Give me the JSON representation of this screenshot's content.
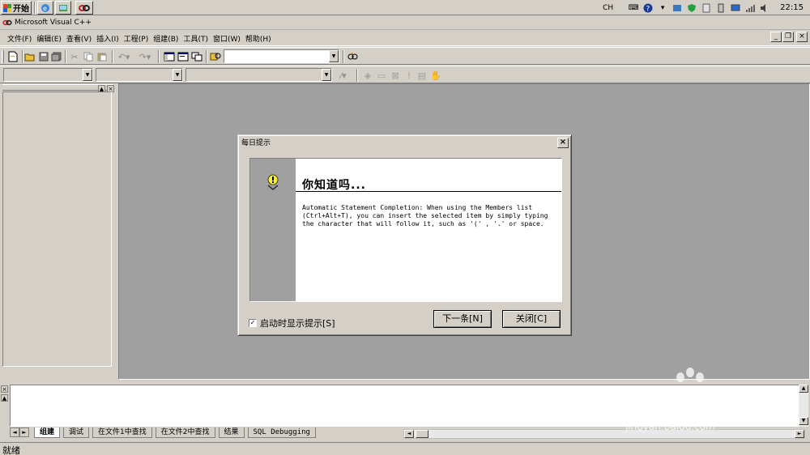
{
  "taskbar": {
    "start_label": "开始",
    "ime": "CH",
    "clock": "22:15"
  },
  "window": {
    "title": "Microsoft Visual C++"
  },
  "menu": {
    "items": [
      "文件(F)",
      "编辑(E)",
      "查看(V)",
      "插入(I)",
      "工程(P)",
      "组建(B)",
      "工具(T)",
      "窗口(W)",
      "帮助(H)"
    ]
  },
  "toolbar": {
    "find_combo_value": ""
  },
  "dialog": {
    "title": "每日提示",
    "heading": "你知道吗...",
    "tip_text": "Automatic Statement Completion: When using the Members list (Ctrl+Alt+T), you can insert the selected item by simply typing the character that will follow it, such as '(' , '.' or space.",
    "startup_checkbox_label": "启动时显示提示[S]",
    "startup_checked": true,
    "next_button": "下一条[N]",
    "close_button": "关闭[C]"
  },
  "output": {
    "tabs": [
      "组建",
      "调试",
      "在文件1中查找",
      "在文件2中查找",
      "结果",
      "SQL Debugging"
    ],
    "active_tab": "组建"
  },
  "status": {
    "text": "就绪"
  },
  "watermark": {
    "logo": "Baidu经验",
    "url": "jingyan.baidu.com"
  }
}
